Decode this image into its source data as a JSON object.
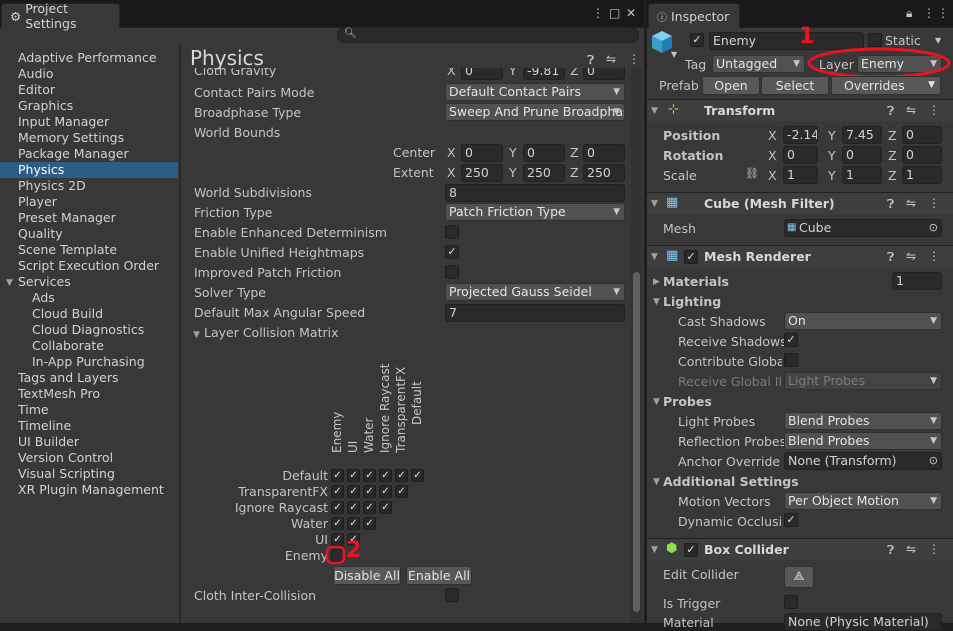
{
  "project_settings": {
    "tab_title": "Project Settings",
    "search_placeholder": "",
    "categories": [
      "Adaptive Performance",
      "Audio",
      "Editor",
      "Graphics",
      "Input Manager",
      "Memory Settings",
      "Package Manager",
      "Physics",
      "Physics 2D",
      "Player",
      "Preset Manager",
      "Quality",
      "Scene Template",
      "Script Execution Order",
      "Services",
      "Ads",
      "Cloud Build",
      "Cloud Diagnostics",
      "Collaborate",
      "In-App Purchasing",
      "Tags and Layers",
      "TextMesh Pro",
      "Time",
      "Timeline",
      "UI Builder",
      "Version Control",
      "Visual Scripting",
      "XR Plugin Management"
    ],
    "selected_category": "Physics",
    "panel_title": "Physics",
    "cloth_gravity": {
      "label": "Cloth Gravity",
      "x": "0",
      "y": "-9.81",
      "z": "0"
    },
    "contact_pairs_mode": {
      "label": "Contact Pairs Mode",
      "value": "Default Contact Pairs"
    },
    "broadphase_type": {
      "label": "Broadphase Type",
      "value": "Sweep And Prune Broadphas"
    },
    "world_bounds": {
      "label": "World Bounds",
      "center_label": "Center",
      "center": {
        "x": "0",
        "y": "0",
        "z": "0"
      },
      "extent_label": "Extent",
      "extent": {
        "x": "250",
        "y": "250",
        "z": "250"
      }
    },
    "world_subdivisions": {
      "label": "World Subdivisions",
      "value": "8"
    },
    "friction_type": {
      "label": "Friction Type",
      "value": "Patch Friction Type"
    },
    "enhanced_determinism": {
      "label": "Enable Enhanced Determinism",
      "checked": false
    },
    "unified_heightmaps": {
      "label": "Enable Unified Heightmaps",
      "checked": true
    },
    "improved_patch_friction": {
      "label": "Improved Patch Friction",
      "checked": false
    },
    "solver_type": {
      "label": "Solver Type",
      "value": "Projected Gauss Seidel"
    },
    "max_angular_speed": {
      "label": "Default Max Angular Speed",
      "value": "7"
    },
    "layer_collision_matrix": {
      "label": "Layer Collision Matrix",
      "columns": [
        "Enemy",
        "UI",
        "Water",
        "Ignore Raycast",
        "TransparentFX",
        "Default"
      ],
      "rows": [
        "Default",
        "TransparentFX",
        "Ignore Raycast",
        "Water",
        "UI",
        "Enemy"
      ],
      "disable_all": "Disable All",
      "enable_all": "Enable All"
    },
    "cloth_inter_collision": {
      "label": "Cloth Inter-Collision",
      "checked": false
    },
    "annotation_2": "2"
  },
  "inspector": {
    "tab_title": "Inspector",
    "object_name": "Enemy",
    "static_label": "Static",
    "tag_label": "Tag",
    "tag_value": "Untagged",
    "layer_label": "Layer",
    "layer_value": "Enemy",
    "prefab_label": "Prefab",
    "open_btn": "Open",
    "select_btn": "Select",
    "overrides_btn": "Overrides",
    "annotation_1": "1",
    "transform": {
      "title": "Transform",
      "position": {
        "label": "Position",
        "x": "-2.14",
        "y": "7.45",
        "z": "0"
      },
      "rotation": {
        "label": "Rotation",
        "x": "0",
        "y": "0",
        "z": "0"
      },
      "scale": {
        "label": "Scale",
        "x": "1",
        "y": "1",
        "z": "1"
      }
    },
    "mesh_filter": {
      "title": "Cube (Mesh Filter)",
      "mesh_label": "Mesh",
      "mesh_value": "Cube"
    },
    "mesh_renderer": {
      "title": "Mesh Renderer",
      "materials_label": "Materials",
      "materials_count": "1",
      "lighting_label": "Lighting",
      "cast_shadows_label": "Cast Shadows",
      "cast_shadows": "On",
      "receive_shadows_label": "Receive Shadows",
      "contribute_gi_label": "Contribute Global I",
      "receive_gi_label": "Receive Global Illu",
      "receive_gi": "Light Probes",
      "probes_label": "Probes",
      "light_probes_label": "Light Probes",
      "light_probes": "Blend Probes",
      "reflection_probes_label": "Reflection Probes",
      "reflection_probes": "Blend Probes",
      "anchor_override_label": "Anchor Override",
      "anchor_override": "None (Transform)",
      "additional_label": "Additional Settings",
      "motion_vectors_label": "Motion Vectors",
      "motion_vectors": "Per Object Motion",
      "dynamic_occlusion_label": "Dynamic Occlusio"
    },
    "box_collider": {
      "title": "Box Collider",
      "edit_collider_label": "Edit Collider",
      "is_trigger_label": "Is Trigger",
      "material_label": "Material",
      "material_value": "None (Physic Material)"
    }
  },
  "colors": {
    "accent": "#2c5d87",
    "annotation": "#e8141e"
  }
}
